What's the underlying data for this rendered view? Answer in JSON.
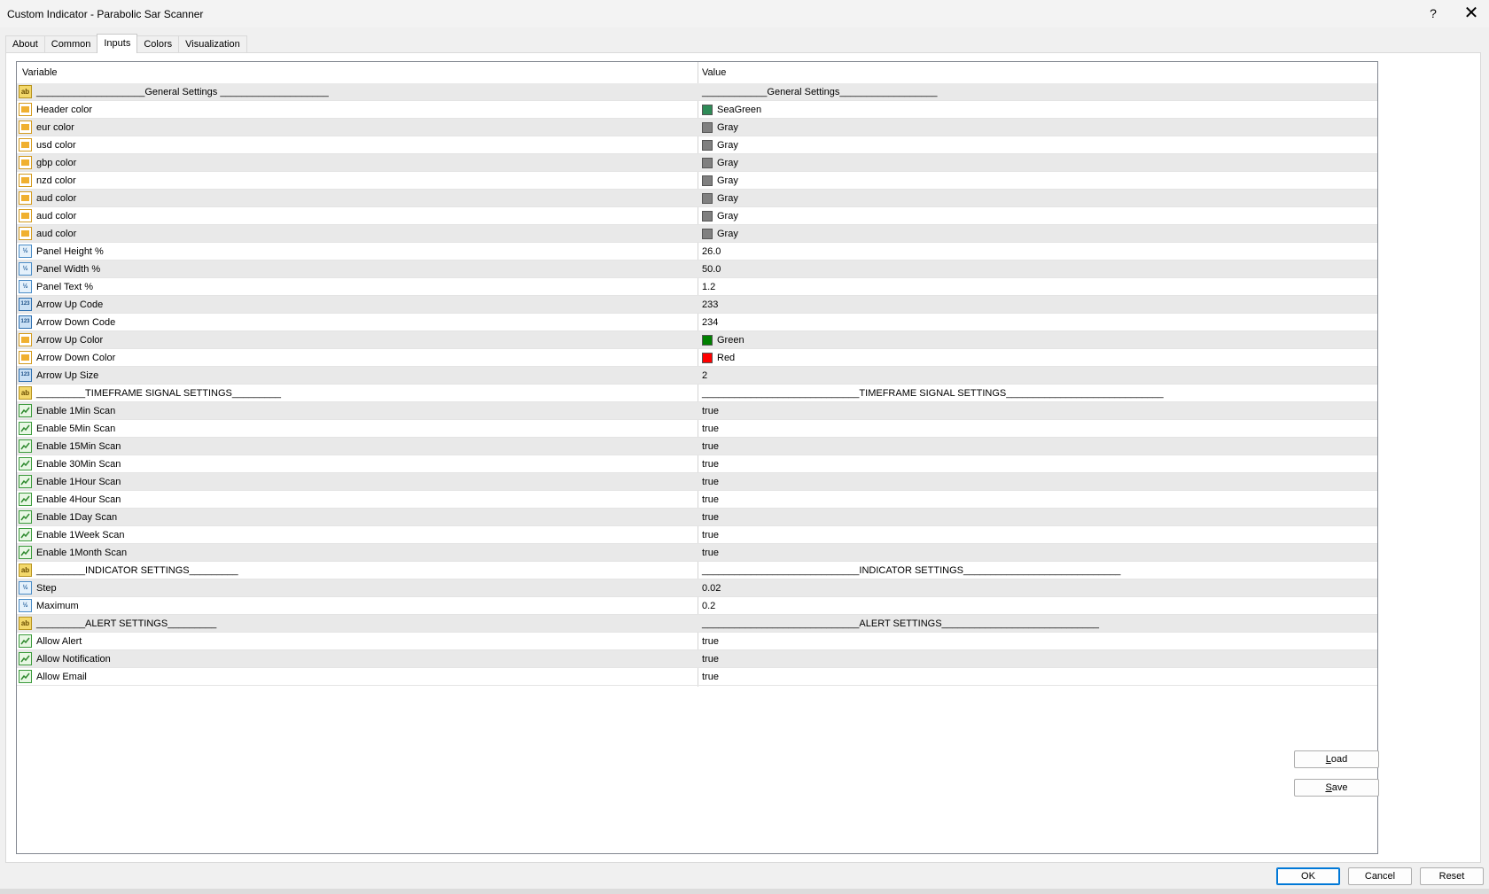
{
  "window": {
    "title": "Custom Indicator - Parabolic Sar Scanner",
    "help": "?",
    "close": "✕"
  },
  "tabs": [
    {
      "label": "About"
    },
    {
      "label": "Common"
    },
    {
      "label": "Inputs",
      "active": true
    },
    {
      "label": "Colors"
    },
    {
      "label": "Visualization"
    }
  ],
  "grid": {
    "headers": {
      "variable": "Variable",
      "value": "Value"
    },
    "rows": [
      {
        "icon": "ab",
        "variable": "____________________General Settings ____________________",
        "value": "____________General Settings__________________"
      },
      {
        "icon": "color",
        "variable": "Header color",
        "value": "SeaGreen",
        "swatch": "#2e8b57"
      },
      {
        "icon": "color",
        "variable": "eur color",
        "value": "Gray",
        "swatch": "#808080"
      },
      {
        "icon": "color",
        "variable": "usd color",
        "value": "Gray",
        "swatch": "#808080"
      },
      {
        "icon": "color",
        "variable": "gbp color",
        "value": "Gray",
        "swatch": "#808080"
      },
      {
        "icon": "color",
        "variable": "nzd color",
        "value": "Gray",
        "swatch": "#808080"
      },
      {
        "icon": "color",
        "variable": "aud color",
        "value": "Gray",
        "swatch": "#808080"
      },
      {
        "icon": "color",
        "variable": "aud color",
        "value": "Gray",
        "swatch": "#808080"
      },
      {
        "icon": "color",
        "variable": "aud color",
        "value": "Gray",
        "swatch": "#808080"
      },
      {
        "icon": "dbl",
        "variable": "Panel Height %",
        "value": "26.0"
      },
      {
        "icon": "dbl",
        "variable": "Panel Width %",
        "value": "50.0"
      },
      {
        "icon": "dbl",
        "variable": "Panel Text %",
        "value": "1.2"
      },
      {
        "icon": "int",
        "variable": "Arrow Up Code",
        "value": "233"
      },
      {
        "icon": "int",
        "variable": "Arrow Down Code",
        "value": "234"
      },
      {
        "icon": "color",
        "variable": "Arrow Up Color",
        "value": "Green",
        "swatch": "#008000"
      },
      {
        "icon": "color",
        "variable": "Arrow Down Color",
        "value": "Red",
        "swatch": "#ff0000"
      },
      {
        "icon": "int",
        "variable": "Arrow Up Size",
        "value": "2"
      },
      {
        "icon": "ab",
        "variable": "_________TIMEFRAME SIGNAL SETTINGS_________",
        "value": "_____________________________TIMEFRAME SIGNAL SETTINGS_____________________________"
      },
      {
        "icon": "bool",
        "variable": "Enable 1Min Scan",
        "value": "true"
      },
      {
        "icon": "bool",
        "variable": "Enable 5Min Scan",
        "value": "true"
      },
      {
        "icon": "bool",
        "variable": "Enable 15Min Scan",
        "value": "true"
      },
      {
        "icon": "bool",
        "variable": "Enable 30Min Scan",
        "value": "true"
      },
      {
        "icon": "bool",
        "variable": "Enable 1Hour Scan",
        "value": "true"
      },
      {
        "icon": "bool",
        "variable": "Enable 4Hour Scan",
        "value": "true"
      },
      {
        "icon": "bool",
        "variable": "Enable 1Day Scan",
        "value": "true"
      },
      {
        "icon": "bool",
        "variable": "Enable 1Week Scan",
        "value": "true"
      },
      {
        "icon": "bool",
        "variable": "Enable 1Month Scan",
        "value": "true"
      },
      {
        "icon": "ab",
        "variable": "_________INDICATOR SETTINGS_________",
        "value": "_____________________________INDICATOR SETTINGS_____________________________"
      },
      {
        "icon": "dbl",
        "variable": "Step",
        "value": "0.02"
      },
      {
        "icon": "dbl",
        "variable": "Maximum",
        "value": "0.2"
      },
      {
        "icon": "ab",
        "variable": "_________ALERT SETTINGS_________",
        "value": "_____________________________ALERT SETTINGS_____________________________"
      },
      {
        "icon": "bool",
        "variable": "Allow Alert",
        "value": "true"
      },
      {
        "icon": "bool",
        "variable": "Allow Notification",
        "value": "true"
      },
      {
        "icon": "bool",
        "variable": "Allow Email",
        "value": "true"
      }
    ]
  },
  "icon_glyphs": {
    "ab": "ab",
    "dbl": "½",
    "int": "123"
  },
  "buttons": {
    "load": {
      "label": "Load",
      "mnemonic": "L",
      "rest": "oad"
    },
    "save": {
      "label": "Save",
      "mnemonic": "S",
      "rest": "ave"
    },
    "ok": "OK",
    "cancel": "Cancel",
    "reset": "Reset"
  }
}
